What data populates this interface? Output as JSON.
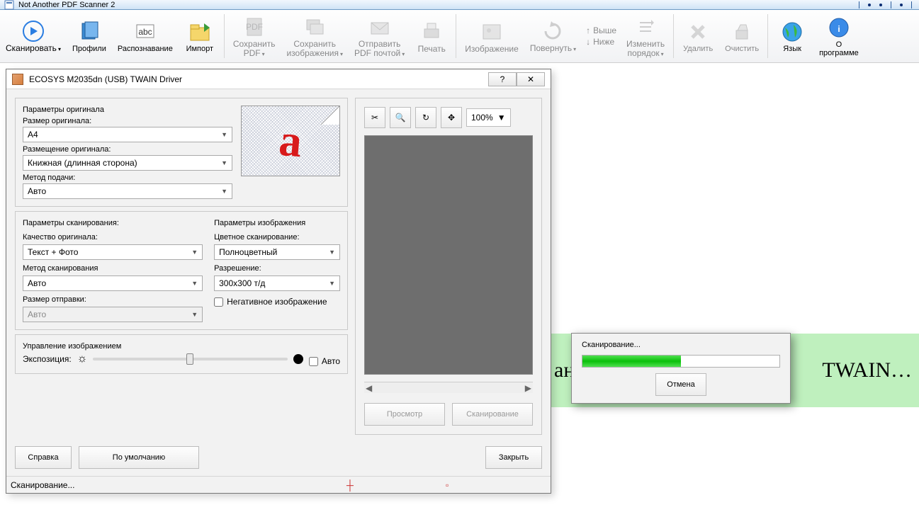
{
  "titlebar": {
    "title": "Not Another PDF Scanner 2"
  },
  "ribbon": {
    "scan": "Сканировать",
    "profiles": "Профили",
    "ocr": "Распознавание",
    "import": "Импорт",
    "save_pdf": "Сохранить\nPDF",
    "save_images": "Сохранить\nизображения",
    "send_pdf": "Отправить\nPDF почтой",
    "print": "Печать",
    "image": "Изображение",
    "rotate": "Повернуть",
    "move_up": "Выше",
    "move_down": "Ниже",
    "reorder": "Изменить\nпорядок",
    "delete": "Удалить",
    "clear": "Очистить",
    "language": "Язык",
    "about": "О\nпрограмме"
  },
  "dialog": {
    "title": "ECOSYS M2035dn (USB) TWAIN Driver",
    "help_btn": "?",
    "close_btn": "✕",
    "orig_params": "Параметры оригинала",
    "orig_size_label": "Размер оригинала:",
    "orig_size_value": "A4",
    "orientation_label": "Размещение оригинала:",
    "orientation_value": "Книжная (длинная сторона)",
    "feed_label": "Метод подачи:",
    "feed_value": "Авто",
    "scan_params": "Параметры сканирования:",
    "quality_label": "Качество оригинала:",
    "quality_value": "Текст + Фото",
    "method_label": "Метод сканирования",
    "method_value": "Авто",
    "send_size_label": "Размер отправки:",
    "send_size_value": "Авто",
    "image_params": "Параметры изображения",
    "color_label": "Цветное сканирование:",
    "color_value": "Полноцветный",
    "resolution_label": "Разрешение:",
    "resolution_value": "300x300 т/д",
    "negative": "Негативное изображение",
    "img_control": "Управление изображением",
    "exposure": "Экспозиция:",
    "auto": "Авто",
    "zoom_value": "100%",
    "preview_btn": "Просмотр",
    "scan_btn": "Сканирование",
    "help": "Справка",
    "defaults": "По умолчанию",
    "close": "Закрыть",
    "status": "Сканирование..."
  },
  "green_strip": {
    "left": "ани",
    "right": "TWAIN…"
  },
  "popup": {
    "label": "Сканирование...",
    "cancel": "Отмена",
    "progress_percent": 50
  }
}
